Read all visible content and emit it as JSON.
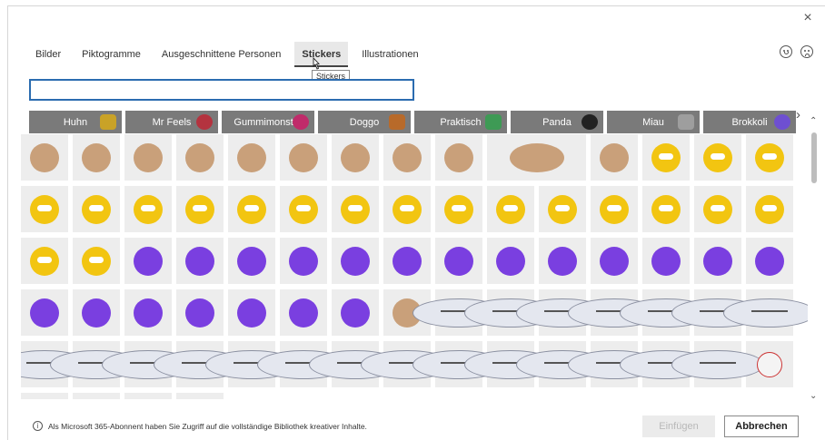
{
  "close_label": "×",
  "tabs": [
    {
      "label": "Bilder",
      "active": false
    },
    {
      "label": "Piktogramme",
      "active": false
    },
    {
      "label": "Ausgeschnittene Personen",
      "active": false
    },
    {
      "label": "Stickers",
      "active": true
    },
    {
      "label": "Illustrationen",
      "active": false
    }
  ],
  "tooltip": "Stickers",
  "search": {
    "value": "",
    "placeholder": ""
  },
  "categories": [
    {
      "label": "Huhn",
      "icon": "chicken-icon",
      "color": "#c9a227"
    },
    {
      "label": "Mr Feels",
      "icon": "heart-icon",
      "color": "#b4333f"
    },
    {
      "label": "Gummimonster",
      "icon": "monster-icon",
      "color": "#c02b6a"
    },
    {
      "label": "Doggo",
      "icon": "dog-icon",
      "color": "#b86a2a"
    },
    {
      "label": "Praktisch",
      "icon": "plant-icon",
      "color": "#3e9a55"
    },
    {
      "label": "Panda",
      "icon": "panda-icon",
      "color": "#222222"
    },
    {
      "label": "Miau",
      "icon": "cat-icon",
      "color": "#9e9e9e"
    },
    {
      "label": "Brokkoli",
      "icon": "broccoli-icon",
      "color": "#6e4fd1"
    }
  ],
  "footer_note": "Als Microsoft 365-Abonnent haben Sie Zugriff auf die vollständige Bibliothek kreativer Inhalte.",
  "buttons": {
    "insert": "Einfügen",
    "cancel": "Abbrechen"
  },
  "colors": {
    "accent": "#2b6cb0",
    "chip_bg": "#7a7a7a",
    "tile_bg": "#ededed",
    "bee": "#f2c511",
    "monster": "#7a3fe0",
    "cat": "#e4e7ef",
    "chicken": "#f4f4f4",
    "pirate": "#c9a07a"
  },
  "stickers": [
    {
      "name": "pirate-anchor-sticker",
      "kind": "pirate"
    },
    {
      "name": "pirate-captain-sticker",
      "kind": "pirate"
    },
    {
      "name": "pirate-flag-sticker",
      "kind": "pirate"
    },
    {
      "name": "pirate-hat-sticker",
      "kind": "pirate"
    },
    {
      "name": "pirate-skeleton-sticker",
      "kind": "pirate"
    },
    {
      "name": "pirate-parrot-sticker",
      "kind": "pirate"
    },
    {
      "name": "pirate-ship-sticker",
      "kind": "pirate"
    },
    {
      "name": "skull-crossbones-sticker",
      "kind": "pirate"
    },
    {
      "name": "pirate-sword-sticker",
      "kind": "pirate"
    },
    {
      "name": "spyglass-sticker",
      "kind": "pirate",
      "wide": true
    },
    {
      "name": "treasure-chest-sticker",
      "kind": "pirate"
    },
    {
      "name": "bee-fire-sticker",
      "kind": "bee"
    },
    {
      "name": "bee-honey-sticker",
      "kind": "bee"
    },
    {
      "name": "bee-group-sticker",
      "kind": "bee"
    },
    {
      "name": "bee-pair-sticker",
      "kind": "bee"
    },
    {
      "name": "bee-wave-sticker",
      "kind": "bee"
    },
    {
      "name": "bee-happy-sticker",
      "kind": "bee"
    },
    {
      "name": "bee-dance-sticker",
      "kind": "bee"
    },
    {
      "name": "bee-duo-sticker",
      "kind": "bee"
    },
    {
      "name": "bee-scream-sticker",
      "kind": "bee"
    },
    {
      "name": "bee-sleep-sticker",
      "kind": "bee"
    },
    {
      "name": "bee-flower-sticker",
      "kind": "bee"
    },
    {
      "name": "bee-location-sticker",
      "kind": "bee"
    },
    {
      "name": "bee-shine-sticker",
      "kind": "bee"
    },
    {
      "name": "bee-fly-sticker",
      "kind": "bee"
    },
    {
      "name": "bee-trash-sticker",
      "kind": "bee"
    },
    {
      "name": "bee-lying-sticker",
      "kind": "bee"
    },
    {
      "name": "bee-sad-sticker",
      "kind": "bee"
    },
    {
      "name": "bee-angry-sticker",
      "kind": "bee"
    },
    {
      "name": "bee-no-sticker",
      "kind": "bee"
    },
    {
      "name": "bee-glasses-sticker",
      "kind": "bee"
    },
    {
      "name": "monster-cheer-sticker",
      "kind": "monster"
    },
    {
      "name": "monster-hug-sticker",
      "kind": "monster"
    },
    {
      "name": "monster-stand-sticker",
      "kind": "monster"
    },
    {
      "name": "monster-pair-sticker",
      "kind": "monster"
    },
    {
      "name": "monster-think-sticker",
      "kind": "monster"
    },
    {
      "name": "monster-duo-sticker",
      "kind": "monster"
    },
    {
      "name": "monster-big-sticker",
      "kind": "monster"
    },
    {
      "name": "monster-friends-sticker",
      "kind": "monster"
    },
    {
      "name": "monster-wave-sticker",
      "kind": "monster"
    },
    {
      "name": "monster-mirror-sticker",
      "kind": "monster"
    },
    {
      "name": "monster-float-sticker",
      "kind": "monster"
    },
    {
      "name": "monster-grey-sticker",
      "kind": "monster"
    },
    {
      "name": "monster-jump-sticker",
      "kind": "monster"
    },
    {
      "name": "monster-cape-sticker",
      "kind": "monster"
    },
    {
      "name": "monster-bath-sticker",
      "kind": "monster"
    },
    {
      "name": "monster-party-sticker",
      "kind": "monster"
    },
    {
      "name": "monster-tall-sticker",
      "kind": "monster"
    },
    {
      "name": "monster-meditate-sticker",
      "kind": "monster"
    },
    {
      "name": "monster-jar-sticker",
      "kind": "monster"
    },
    {
      "name": "monster-food-sticker",
      "kind": "monster"
    },
    {
      "name": "dog-sign-sticker",
      "kind": "pirate"
    },
    {
      "name": "cat-sleep-sticker",
      "kind": "cat"
    },
    {
      "name": "cat-laptop-sticker",
      "kind": "cat"
    },
    {
      "name": "cat-lying-sticker",
      "kind": "cat"
    },
    {
      "name": "cat-paper-sticker",
      "kind": "cat"
    },
    {
      "name": "cat-board-sticker",
      "kind": "cat"
    },
    {
      "name": "cat-messy-sticker",
      "kind": "cat"
    },
    {
      "name": "cat-screen-sticker",
      "kind": "cat"
    },
    {
      "name": "cat-sit-sticker",
      "kind": "cat"
    },
    {
      "name": "cat-tie-sticker",
      "kind": "cat"
    },
    {
      "name": "cat-wave-sticker",
      "kind": "cat"
    },
    {
      "name": "cat-stand-sticker",
      "kind": "cat"
    },
    {
      "name": "cat-coffee-sticker",
      "kind": "cat"
    },
    {
      "name": "cat-chair-sticker",
      "kind": "cat"
    },
    {
      "name": "cat-tired-sticker",
      "kind": "cat"
    },
    {
      "name": "cat-peek-sticker",
      "kind": "cat"
    },
    {
      "name": "cat-office-sticker",
      "kind": "cat"
    },
    {
      "name": "cat-question-sticker",
      "kind": "cat"
    },
    {
      "name": "cat-shout-sticker",
      "kind": "cat"
    },
    {
      "name": "cat-computer-sticker",
      "kind": "cat"
    },
    {
      "name": "cat-note-sticker",
      "kind": "cat"
    },
    {
      "name": "cat-sleeping-sticker",
      "kind": "cat"
    },
    {
      "name": "chicken-peek-sticker",
      "kind": "chicken"
    },
    {
      "name": "chicken-flowers-sticker",
      "kind": "chicken"
    },
    {
      "name": "chicken-run-sticker",
      "kind": "chicken"
    },
    {
      "name": "chicken-cool-sticker",
      "kind": "chicken"
    },
    {
      "name": "chicken-stand-sticker",
      "kind": "chicken"
    }
  ]
}
